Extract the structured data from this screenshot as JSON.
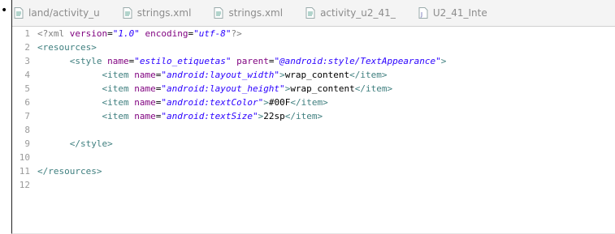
{
  "tabs": [
    {
      "label": "land/activity_u",
      "icon": "xml-file-icon"
    },
    {
      "label": "strings.xml",
      "icon": "xml-file-icon"
    },
    {
      "label": "strings.xml",
      "icon": "xml-file-icon"
    },
    {
      "label": "activity_u2_41_",
      "icon": "xml-file-icon"
    },
    {
      "label": "U2_41_Inte",
      "icon": "java-file-icon"
    }
  ],
  "editor": {
    "line_numbers": [
      "1",
      "2",
      "3",
      "4",
      "5",
      "6",
      "7",
      "8",
      "9",
      "10",
      "11",
      "12"
    ],
    "line1": {
      "pi_open": "<?xml ",
      "a1": "version",
      "eq1": "=",
      "v1": "\"1.0\"",
      "a2": " encoding",
      "eq2": "=",
      "v2": "\"utf-8\"",
      "pi_close": "?>"
    },
    "line2": {
      "tag": "<resources>"
    },
    "line3": {
      "open": "<style ",
      "a1": "name",
      "v1": "\"estilo_etiquetas\"",
      "a2": " parent",
      "v2": "\"@android:style/TextAppearance\"",
      "close": ">"
    },
    "items": [
      {
        "name": "\"android:layout_width\"",
        "value": "wrap_content"
      },
      {
        "name": "\"android:layout_height\"",
        "value": "wrap_content"
      },
      {
        "name": "\"android:textColor\"",
        "value": "#00F"
      },
      {
        "name": "\"android:textSize\"",
        "value": "22sp"
      }
    ],
    "item_open": "<item ",
    "item_attr": "name",
    "item_eq": "=",
    "item_gt": ">",
    "item_close": "</item>",
    "line9": {
      "tag": "</style>"
    },
    "line11": {
      "tag": "</resources>"
    }
  }
}
